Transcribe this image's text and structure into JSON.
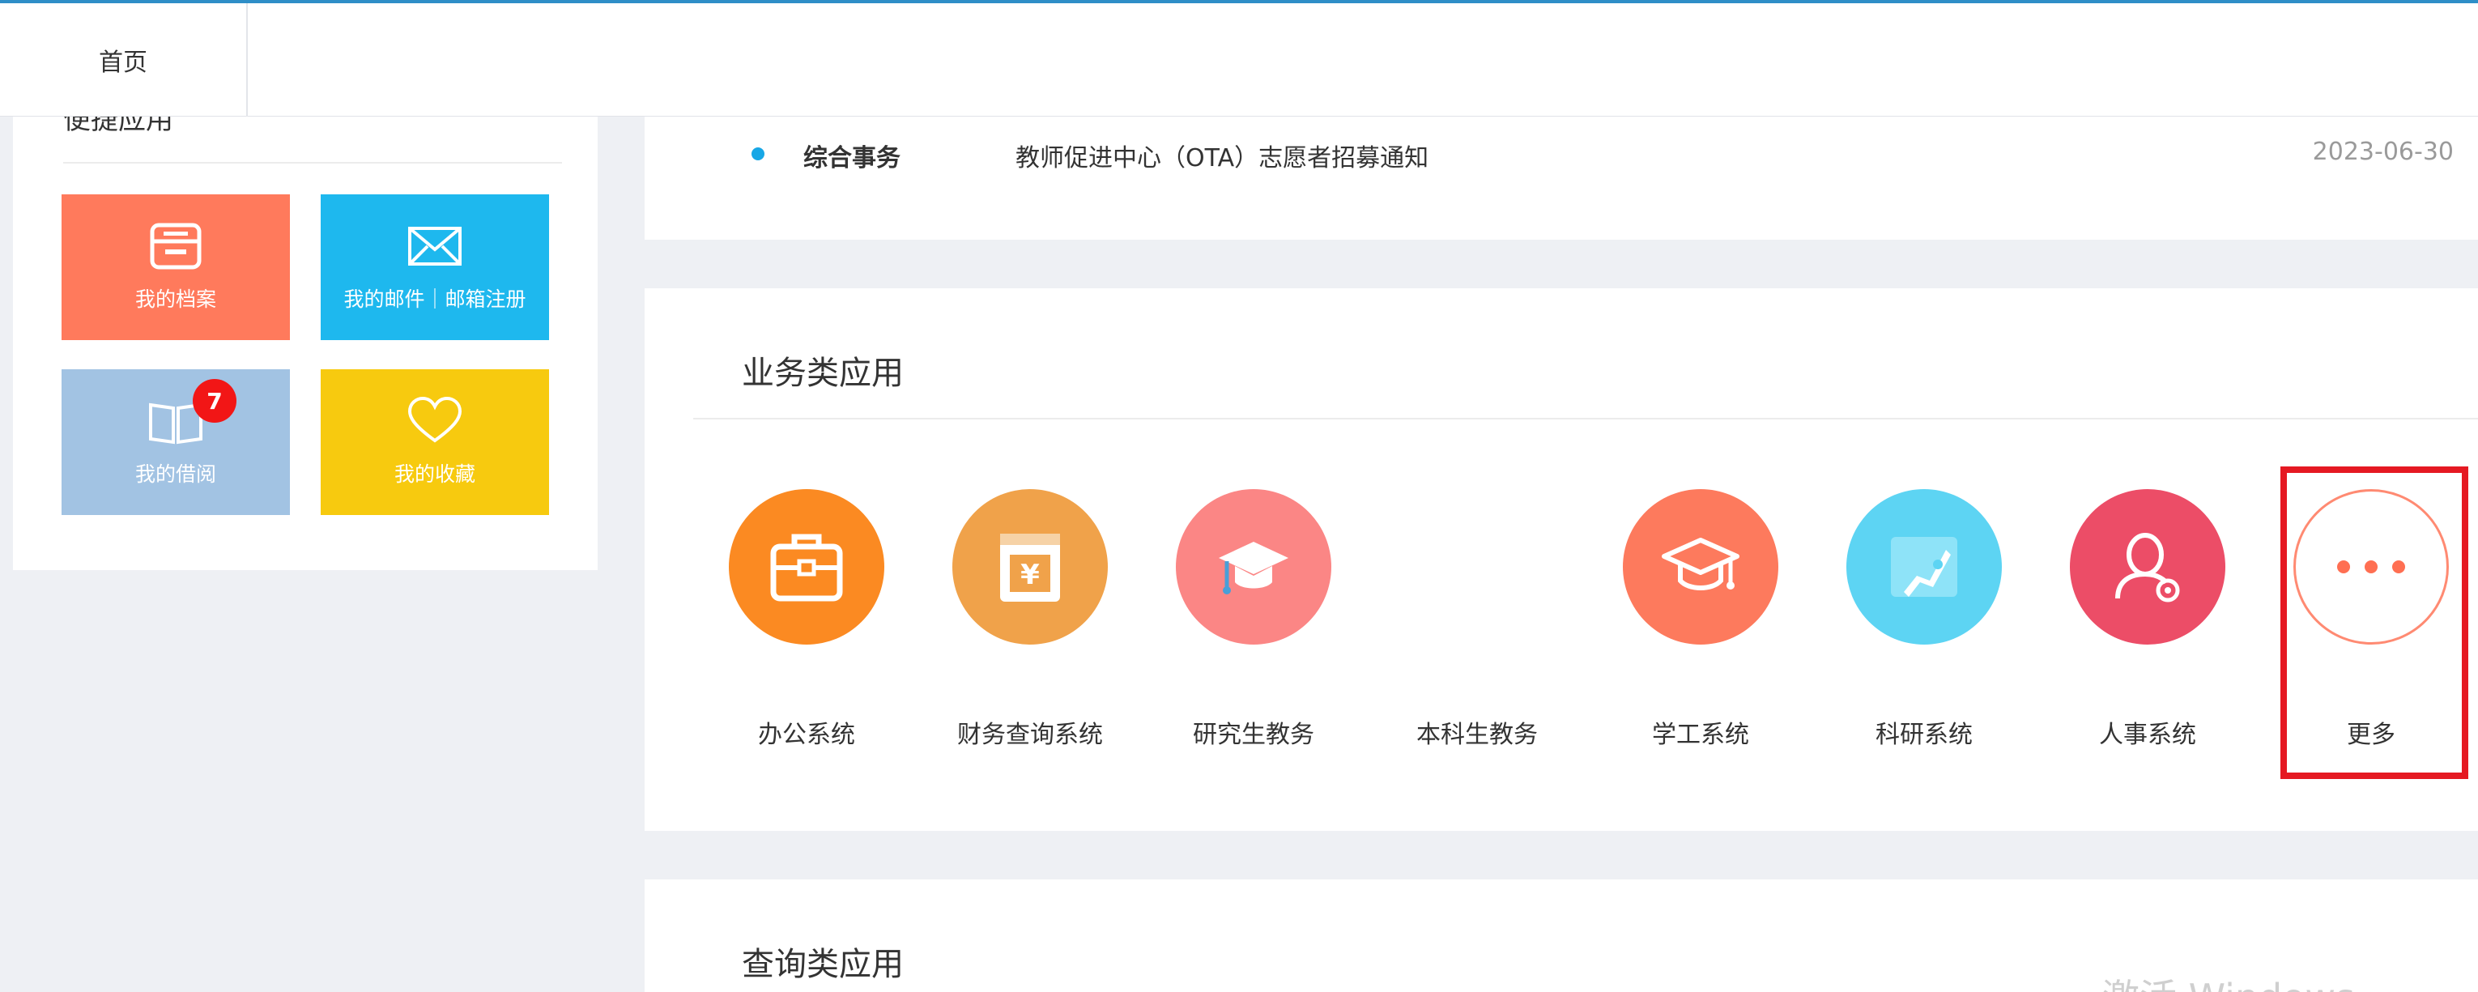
{
  "topbar": {
    "home_tab": "首页"
  },
  "quick_apps": {
    "title": "便捷应用",
    "tiles": [
      {
        "label": "我的档案",
        "icon": "archive-box-icon",
        "color": "#ff7a5c"
      },
      {
        "label": "我的邮件｜邮箱注册",
        "icon": "envelope-icon",
        "color": "#1eb8ee"
      },
      {
        "label": "我的借阅",
        "icon": "open-book-icon",
        "color": "#a2c3e3",
        "badge": "7"
      },
      {
        "label": "我的收藏",
        "icon": "heart-icon",
        "color": "#f7ca0f"
      }
    ]
  },
  "notice": {
    "category": "综合事务",
    "title": "教师促进中心（OTA）志愿者招募通知",
    "date": "2023-06-30"
  },
  "business_apps": {
    "title": "业务类应用",
    "apps": [
      {
        "label": "办公系统",
        "icon": "briefcase-icon",
        "color": "#fb8a22"
      },
      {
        "label": "财务查询系统",
        "icon": "finance-yuan-icon",
        "color": "#f0a24a"
      },
      {
        "label": "研究生教务",
        "icon": "graduate-cap-icon",
        "color": "#fb8685"
      },
      {
        "label": "本科生教务",
        "icon": "",
        "color": ""
      },
      {
        "label": "学工系统",
        "icon": "mortarboard-icon",
        "color": "#fd7a5d"
      },
      {
        "label": "科研系统",
        "icon": "rocket-icon",
        "color": "#5dd4f3"
      },
      {
        "label": "人事系统",
        "icon": "person-gear-icon",
        "color": "#ec4d67"
      },
      {
        "label": "更多",
        "icon": "more-dots-icon",
        "color": "#ff6f52"
      }
    ]
  },
  "query_apps": {
    "title": "查询类应用"
  },
  "watermark": "激活 Windows"
}
